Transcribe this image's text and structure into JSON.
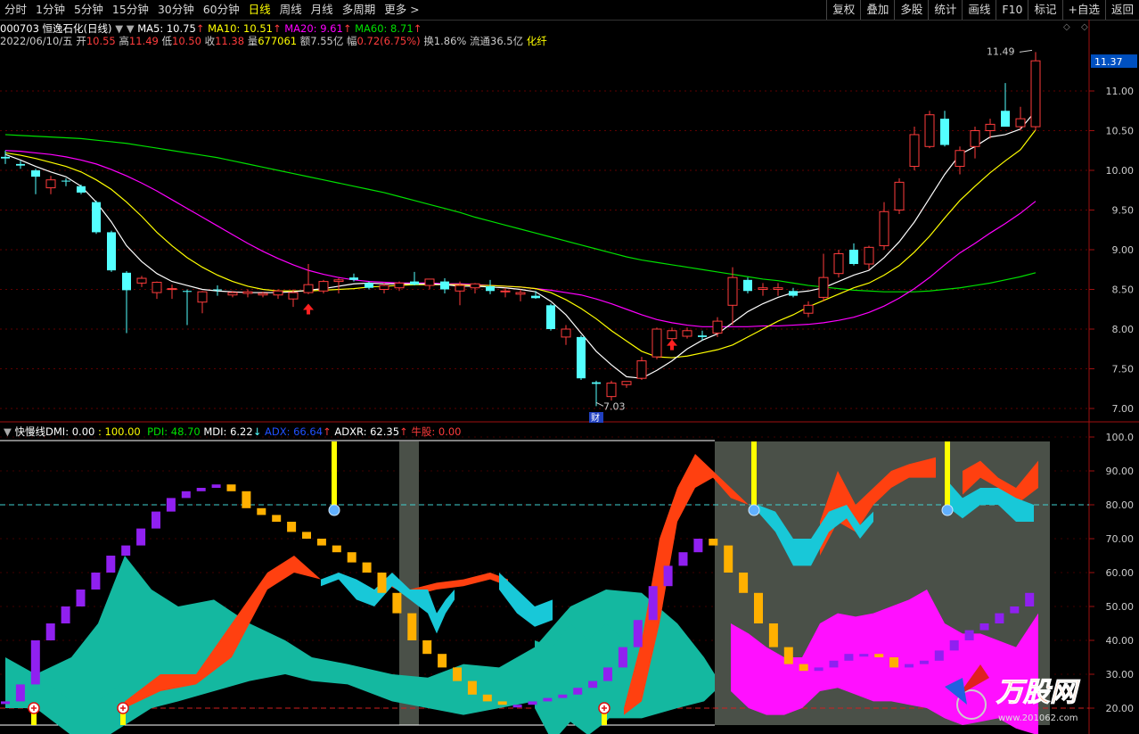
{
  "toolbar": {
    "periods": [
      "分时",
      "1分钟",
      "5分钟",
      "15分钟",
      "30分钟",
      "60分钟",
      "日线",
      "周线",
      "月线",
      "多周期",
      "更多 >"
    ],
    "active_period": "日线",
    "right_buttons": [
      "复权",
      "叠加",
      "多股",
      "统计",
      "画线",
      "F10",
      "标记",
      "+自选",
      "返回"
    ]
  },
  "quote": {
    "code_name": "000703 恒逸石化(日线)",
    "ma5": "MA5: 10.75",
    "ma10": "MA10: 10.51",
    "ma20": "MA20: 9.61",
    "ma60": "MA60: 8.71",
    "date": "2022/06/10/五",
    "open_label": "开",
    "open": "10.55",
    "high_label": "高",
    "high": "11.49",
    "low_label": "低",
    "low": "10.50",
    "close_label": "收",
    "close": "11.38",
    "vol_label": "量",
    "vol": "677061",
    "amt_label": "额",
    "amt": "7.55亿",
    "chg_label": "幅",
    "chg": "0.72(6.75%)",
    "turn": "换1.86%",
    "float": "流通36.5亿",
    "sector": "化纤"
  },
  "main_chart": {
    "price_axis": [
      "11.37",
      "11.00",
      "10.50",
      "10.00",
      "9.50",
      "9.00",
      "8.50",
      "8.00",
      "7.50",
      "7.00"
    ],
    "current_price": "11.37",
    "high_label": "11.49",
    "low_label": "7.03",
    "event_tag": "财",
    "colors": {
      "up": "#ff3c3c",
      "down": "#54ffff",
      "ma5": "#ffffff",
      "ma10": "#ffff00",
      "ma20": "#ff00ff",
      "ma60": "#00e000"
    }
  },
  "indicator": {
    "name": "快慢线DMI",
    "v1": ": 0.00",
    "v2": ": 100.00",
    "pdi": "PDI: 48.70",
    "mdi": "MDI: 6.22",
    "adx": "ADX: 66.64",
    "adxr": "ADXR: 62.35",
    "niu": "牛股: 0.00",
    "axis": [
      "100.0",
      "90.00",
      "80.00",
      "70.00",
      "60.00",
      "50.00",
      "40.00",
      "30.00",
      "20.00"
    ]
  },
  "watermark": {
    "brand": "万股网",
    "url": "www.201062.com"
  },
  "chart_data": {
    "type": "candlestick",
    "ylim": [
      7.0,
      11.5
    ],
    "candles": [
      {
        "o": 10.17,
        "h": 10.25,
        "l": 10.08,
        "c": 10.15
      },
      {
        "o": 10.08,
        "h": 10.12,
        "l": 10.02,
        "c": 10.06
      },
      {
        "o": 10.0,
        "h": 10.02,
        "l": 9.7,
        "c": 9.92
      },
      {
        "o": 9.78,
        "h": 9.93,
        "l": 9.7,
        "c": 9.88
      },
      {
        "o": 9.87,
        "h": 9.9,
        "l": 9.8,
        "c": 9.86
      },
      {
        "o": 9.8,
        "h": 9.82,
        "l": 9.7,
        "c": 9.72
      },
      {
        "o": 9.6,
        "h": 9.62,
        "l": 9.2,
        "c": 9.22
      },
      {
        "o": 9.22,
        "h": 9.24,
        "l": 8.72,
        "c": 8.74
      },
      {
        "o": 8.71,
        "h": 8.73,
        "l": 7.95,
        "c": 8.49
      },
      {
        "o": 8.58,
        "h": 8.67,
        "l": 8.53,
        "c": 8.64
      },
      {
        "o": 8.46,
        "h": 8.6,
        "l": 8.38,
        "c": 8.59
      },
      {
        "o": 8.5,
        "h": 8.56,
        "l": 8.38,
        "c": 8.51
      },
      {
        "o": 8.48,
        "h": 8.5,
        "l": 8.05,
        "c": 8.47
      },
      {
        "o": 8.34,
        "h": 8.48,
        "l": 8.2,
        "c": 8.47
      },
      {
        "o": 8.5,
        "h": 8.55,
        "l": 8.42,
        "c": 8.49
      },
      {
        "o": 8.43,
        "h": 8.48,
        "l": 8.4,
        "c": 8.46
      },
      {
        "o": 8.45,
        "h": 8.5,
        "l": 8.4,
        "c": 8.47
      },
      {
        "o": 8.43,
        "h": 8.47,
        "l": 8.4,
        "c": 8.45
      },
      {
        "o": 8.43,
        "h": 8.5,
        "l": 8.38,
        "c": 8.48
      },
      {
        "o": 8.38,
        "h": 8.5,
        "l": 8.28,
        "c": 8.46
      },
      {
        "o": 8.46,
        "h": 8.82,
        "l": 8.44,
        "c": 8.56
      },
      {
        "o": 8.48,
        "h": 8.62,
        "l": 8.45,
        "c": 8.6
      },
      {
        "o": 8.6,
        "h": 8.64,
        "l": 8.45,
        "c": 8.62
      },
      {
        "o": 8.65,
        "h": 8.7,
        "l": 8.6,
        "c": 8.62
      },
      {
        "o": 8.58,
        "h": 8.6,
        "l": 8.5,
        "c": 8.52
      },
      {
        "o": 8.5,
        "h": 8.58,
        "l": 8.45,
        "c": 8.55
      },
      {
        "o": 8.52,
        "h": 8.6,
        "l": 8.48,
        "c": 8.58
      },
      {
        "o": 8.6,
        "h": 8.72,
        "l": 8.55,
        "c": 8.56
      },
      {
        "o": 8.55,
        "h": 8.62,
        "l": 8.5,
        "c": 8.63
      },
      {
        "o": 8.6,
        "h": 8.64,
        "l": 8.45,
        "c": 8.5
      },
      {
        "o": 8.48,
        "h": 8.6,
        "l": 8.3,
        "c": 8.55
      },
      {
        "o": 8.52,
        "h": 8.58,
        "l": 8.45,
        "c": 8.57
      },
      {
        "o": 8.54,
        "h": 8.62,
        "l": 8.44,
        "c": 8.48
      },
      {
        "o": 8.48,
        "h": 8.52,
        "l": 8.4,
        "c": 8.48
      },
      {
        "o": 8.44,
        "h": 8.5,
        "l": 8.35,
        "c": 8.46
      },
      {
        "o": 8.42,
        "h": 8.48,
        "l": 8.38,
        "c": 8.39
      },
      {
        "o": 8.3,
        "h": 8.32,
        "l": 7.98,
        "c": 8.0
      },
      {
        "o": 7.9,
        "h": 8.05,
        "l": 7.8,
        "c": 8.0
      },
      {
        "o": 7.9,
        "h": 7.92,
        "l": 7.36,
        "c": 7.38
      },
      {
        "o": 7.33,
        "h": 7.35,
        "l": 7.03,
        "c": 7.31
      },
      {
        "o": 7.15,
        "h": 7.35,
        "l": 7.1,
        "c": 7.32
      },
      {
        "o": 7.3,
        "h": 7.34,
        "l": 7.26,
        "c": 7.34
      },
      {
        "o": 7.38,
        "h": 7.65,
        "l": 7.36,
        "c": 7.6
      },
      {
        "o": 7.65,
        "h": 8.02,
        "l": 7.62,
        "c": 8.0
      },
      {
        "o": 7.88,
        "h": 8.02,
        "l": 7.75,
        "c": 7.98
      },
      {
        "o": 7.91,
        "h": 8.02,
        "l": 7.88,
        "c": 7.98
      },
      {
        "o": 7.92,
        "h": 7.98,
        "l": 7.86,
        "c": 7.9
      },
      {
        "o": 7.95,
        "h": 8.15,
        "l": 7.9,
        "c": 8.1
      },
      {
        "o": 8.3,
        "h": 8.78,
        "l": 8.05,
        "c": 8.65
      },
      {
        "o": 8.62,
        "h": 8.65,
        "l": 8.45,
        "c": 8.48
      },
      {
        "o": 8.5,
        "h": 8.58,
        "l": 8.42,
        "c": 8.52
      },
      {
        "o": 8.5,
        "h": 8.58,
        "l": 8.42,
        "c": 8.52
      },
      {
        "o": 8.48,
        "h": 8.52,
        "l": 8.4,
        "c": 8.42
      },
      {
        "o": 8.2,
        "h": 8.35,
        "l": 8.15,
        "c": 8.3
      },
      {
        "o": 8.4,
        "h": 8.95,
        "l": 8.35,
        "c": 8.65
      },
      {
        "o": 8.7,
        "h": 9.0,
        "l": 8.65,
        "c": 8.95
      },
      {
        "o": 9.0,
        "h": 9.08,
        "l": 8.8,
        "c": 8.82
      },
      {
        "o": 8.82,
        "h": 9.05,
        "l": 8.75,
        "c": 9.03
      },
      {
        "o": 9.05,
        "h": 9.6,
        "l": 9.0,
        "c": 9.48
      },
      {
        "o": 9.5,
        "h": 9.9,
        "l": 9.45,
        "c": 9.85
      },
      {
        "o": 10.05,
        "h": 10.55,
        "l": 10.0,
        "c": 10.45
      },
      {
        "o": 10.3,
        "h": 10.75,
        "l": 10.28,
        "c": 10.7
      },
      {
        "o": 10.65,
        "h": 10.75,
        "l": 10.3,
        "c": 10.32
      },
      {
        "o": 10.05,
        "h": 10.3,
        "l": 9.95,
        "c": 10.25
      },
      {
        "o": 10.3,
        "h": 10.55,
        "l": 10.15,
        "c": 10.5
      },
      {
        "o": 10.5,
        "h": 10.65,
        "l": 10.4,
        "c": 10.58
      },
      {
        "o": 10.75,
        "h": 11.1,
        "l": 10.6,
        "c": 10.55
      },
      {
        "o": 10.55,
        "h": 10.8,
        "l": 10.5,
        "c": 10.65
      },
      {
        "o": 10.55,
        "h": 11.49,
        "l": 10.5,
        "c": 11.38
      }
    ],
    "ma5": [
      10.2,
      10.13,
      10.05,
      9.98,
      9.92,
      9.8,
      9.6,
      9.35,
      9.05,
      8.85,
      8.7,
      8.6,
      8.55,
      8.5,
      8.48,
      8.47,
      8.46,
      8.46,
      8.46,
      8.47,
      8.49,
      8.51,
      8.54,
      8.57,
      8.58,
      8.57,
      8.57,
      8.57,
      8.57,
      8.56,
      8.54,
      8.54,
      8.53,
      8.52,
      8.5,
      8.47,
      8.35,
      8.18,
      7.95,
      7.72,
      7.55,
      7.4,
      7.38,
      7.48,
      7.6,
      7.75,
      7.86,
      7.94,
      8.08,
      8.22,
      8.32,
      8.4,
      8.46,
      8.48,
      8.52,
      8.6,
      8.68,
      8.74,
      8.9,
      9.1,
      9.35,
      9.65,
      9.95,
      10.2,
      10.3,
      10.42,
      10.45,
      10.52,
      10.75
    ],
    "ma10": [
      10.22,
      10.19,
      10.15,
      10.1,
      10.05,
      9.98,
      9.88,
      9.76,
      9.6,
      9.42,
      9.22,
      9.05,
      8.9,
      8.78,
      8.68,
      8.6,
      8.54,
      8.5,
      8.48,
      8.48,
      8.48,
      8.49,
      8.5,
      8.51,
      8.53,
      8.54,
      8.55,
      8.56,
      8.56,
      8.56,
      8.56,
      8.55,
      8.55,
      8.54,
      8.53,
      8.51,
      8.46,
      8.37,
      8.26,
      8.13,
      7.98,
      7.85,
      7.72,
      7.65,
      7.64,
      7.66,
      7.7,
      7.74,
      7.8,
      7.9,
      8.0,
      8.1,
      8.18,
      8.28,
      8.36,
      8.44,
      8.52,
      8.58,
      8.68,
      8.8,
      8.97,
      9.17,
      9.4,
      9.62,
      9.8,
      9.97,
      10.12,
      10.26,
      10.51
    ],
    "ma20": [
      10.25,
      10.24,
      10.22,
      10.2,
      10.17,
      10.13,
      10.08,
      10.01,
      9.93,
      9.84,
      9.74,
      9.63,
      9.52,
      9.41,
      9.3,
      9.19,
      9.08,
      8.98,
      8.89,
      8.81,
      8.74,
      8.69,
      8.65,
      8.62,
      8.6,
      8.59,
      8.58,
      8.58,
      8.58,
      8.57,
      8.57,
      8.56,
      8.55,
      8.54,
      8.53,
      8.51,
      8.49,
      8.46,
      8.43,
      8.38,
      8.32,
      8.25,
      8.18,
      8.12,
      8.08,
      8.05,
      8.03,
      8.03,
      8.03,
      8.03,
      8.04,
      8.04,
      8.05,
      8.06,
      8.08,
      8.11,
      8.15,
      8.21,
      8.29,
      8.39,
      8.51,
      8.65,
      8.81,
      8.96,
      9.08,
      9.21,
      9.33,
      9.46,
      9.61
    ],
    "ma60": [
      10.45,
      10.44,
      10.43,
      10.42,
      10.41,
      10.4,
      10.38,
      10.36,
      10.34,
      10.31,
      10.28,
      10.25,
      10.22,
      10.19,
      10.16,
      10.12,
      10.08,
      10.04,
      10.0,
      9.96,
      9.92,
      9.88,
      9.84,
      9.8,
      9.76,
      9.72,
      9.67,
      9.62,
      9.57,
      9.52,
      9.47,
      9.41,
      9.36,
      9.31,
      9.26,
      9.21,
      9.16,
      9.11,
      9.06,
      9.01,
      8.96,
      8.91,
      8.87,
      8.84,
      8.81,
      8.78,
      8.75,
      8.72,
      8.69,
      8.66,
      8.63,
      8.61,
      8.58,
      8.55,
      8.53,
      8.51,
      8.49,
      8.48,
      8.47,
      8.47,
      8.47,
      8.48,
      8.5,
      8.52,
      8.55,
      8.58,
      8.62,
      8.66,
      8.71
    ],
    "dmi_bars": [
      22,
      27,
      40,
      45,
      50,
      55,
      60,
      65,
      68,
      73,
      78,
      82,
      84,
      85,
      86,
      84,
      79,
      77,
      75,
      72,
      70,
      68,
      66,
      63,
      60,
      54,
      48,
      40,
      36,
      32,
      28,
      24,
      22,
      21,
      21,
      22,
      23,
      24,
      26,
      28,
      32,
      38,
      46,
      56,
      62,
      66,
      70,
      68,
      60,
      54,
      45,
      38,
      33,
      31,
      32,
      34,
      36,
      36,
      35,
      32,
      33,
      34,
      37,
      40,
      43,
      45,
      48,
      50,
      54,
      58,
      62,
      67,
      64,
      61,
      60,
      59,
      58,
      59,
      60,
      61,
      63,
      66
    ]
  }
}
